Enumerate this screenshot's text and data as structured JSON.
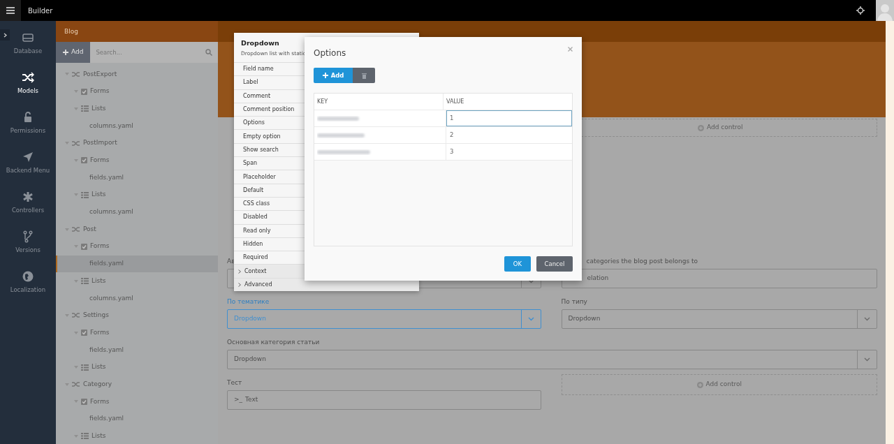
{
  "topbar": {
    "title": "Builder"
  },
  "sidebar": {
    "items": [
      {
        "label": "Database",
        "selected": false
      },
      {
        "label": "Models",
        "selected": true
      },
      {
        "label": "Permissions",
        "selected": false
      },
      {
        "label": "Backend Menu",
        "selected": false
      },
      {
        "label": "Controllers",
        "selected": false
      },
      {
        "label": "Versions",
        "selected": false
      },
      {
        "label": "Localization",
        "selected": false
      }
    ]
  },
  "tree_panel": {
    "title": "Blog",
    "add_button": "Add",
    "search": {
      "placeholder": "Search..."
    },
    "items": [
      {
        "label": "PostExport",
        "kind": "model",
        "selected": false,
        "children": [
          {
            "label": "Forms",
            "kind": "forms",
            "selected": false
          },
          {
            "label": "Lists",
            "kind": "lists",
            "selected": false,
            "children": [
              {
                "label": "columns.yaml",
                "kind": "file",
                "selected": false
              }
            ]
          }
        ]
      },
      {
        "label": "PostImport",
        "kind": "model",
        "selected": false,
        "children": [
          {
            "label": "Forms",
            "kind": "forms",
            "selected": false,
            "children": [
              {
                "label": "fields.yaml",
                "kind": "file",
                "selected": false
              }
            ]
          },
          {
            "label": "Lists",
            "kind": "lists",
            "selected": false,
            "children": [
              {
                "label": "columns.yaml",
                "kind": "file",
                "selected": false
              }
            ]
          }
        ]
      },
      {
        "label": "Post",
        "kind": "model",
        "selected": false,
        "children": [
          {
            "label": "Forms",
            "kind": "forms",
            "selected": false,
            "children": [
              {
                "label": "fields.yaml",
                "kind": "file",
                "selected": true
              }
            ]
          },
          {
            "label": "Lists",
            "kind": "lists",
            "selected": false,
            "children": [
              {
                "label": "columns.yaml",
                "kind": "file",
                "selected": false
              }
            ]
          }
        ]
      },
      {
        "label": "Settings",
        "kind": "model",
        "selected": false,
        "children": [
          {
            "label": "Forms",
            "kind": "forms",
            "selected": false,
            "children": [
              {
                "label": "fields.yaml",
                "kind": "file",
                "selected": false
              }
            ]
          },
          {
            "label": "Lists",
            "kind": "lists",
            "selected": false
          }
        ]
      },
      {
        "label": "Category",
        "kind": "model",
        "selected": false,
        "children": [
          {
            "label": "Forms",
            "kind": "forms",
            "selected": false,
            "children": [
              {
                "label": "fields.yaml",
                "kind": "file",
                "selected": false
              }
            ]
          },
          {
            "label": "Lists",
            "kind": "lists",
            "selected": false
          }
        ]
      }
    ]
  },
  "form": {
    "add_control_top": "Add control",
    "rows": [
      {
        "kind": "pair",
        "left": {
          "label": "Ав",
          "kind": "select",
          "focused": false
        },
        "right": {
          "label": "categories the blog post belongs to",
          "kind": "input",
          "value": "elation",
          "focused": false
        }
      },
      {
        "kind": "pair",
        "left": {
          "label": "По тематике",
          "kind": "select",
          "value": "Dropdown",
          "focused": true
        },
        "right": {
          "label": "По типу",
          "kind": "select",
          "value": "Dropdown",
          "focused": false
        }
      },
      {
        "kind": "full",
        "left": {
          "label": "Основная категория статьи",
          "kind": "select",
          "value": "Dropdown",
          "focused": false
        }
      },
      {
        "kind": "pair",
        "left": {
          "label": "Тест",
          "kind": "text",
          "prompt": ">_",
          "value": "Text",
          "focused": false
        },
        "right": {
          "kind": "add",
          "value": "Add control"
        }
      }
    ]
  },
  "properties_popup": {
    "title": "Dropdown",
    "subtitle": "Dropdown list with static",
    "items": [
      {
        "label": "Field name",
        "kind": "property"
      },
      {
        "label": "Label",
        "kind": "property"
      },
      {
        "label": "Comment",
        "kind": "property"
      },
      {
        "label": "Comment position",
        "kind": "property"
      },
      {
        "label": "Options",
        "kind": "property"
      },
      {
        "label": "Empty option",
        "kind": "property"
      },
      {
        "label": "Show search",
        "kind": "property"
      },
      {
        "label": "Span",
        "kind": "property"
      },
      {
        "label": "Placeholder",
        "kind": "property"
      },
      {
        "label": "Default",
        "kind": "property"
      },
      {
        "label": "CSS class",
        "kind": "property"
      },
      {
        "label": "Disabled",
        "kind": "property"
      },
      {
        "label": "Read only",
        "kind": "property"
      },
      {
        "label": "Hidden",
        "kind": "property"
      },
      {
        "label": "Required",
        "kind": "property"
      },
      {
        "label": "Context",
        "kind": "group"
      },
      {
        "label": "Advanced",
        "kind": "group"
      }
    ]
  },
  "modal": {
    "title": "Options",
    "add_button": "Add",
    "columns": [
      "KEY",
      "VALUE"
    ],
    "rows": [
      {
        "value": "1",
        "focused": true
      },
      {
        "value": "2",
        "focused": false
      },
      {
        "value": "3",
        "focused": false
      }
    ],
    "ok_button": "OK",
    "cancel_button": "Cancel"
  }
}
